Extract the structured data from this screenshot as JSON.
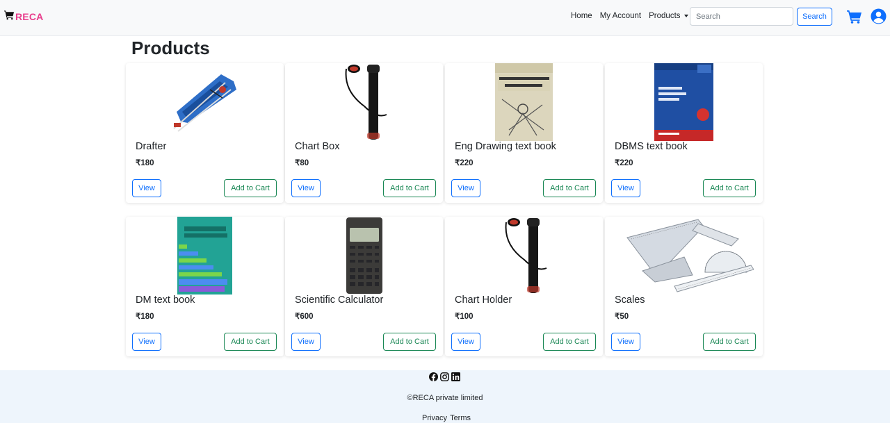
{
  "brand": {
    "name": "RECA",
    "color": "#e83e8c",
    "icon": "cart-icon"
  },
  "nav": {
    "home": "Home",
    "account": "My Account",
    "products": "Products",
    "search_placeholder": "Search",
    "search_button": "Search",
    "cart_icon": "cart-icon",
    "user_icon": "user-circle-icon",
    "accent": "#0d6efd"
  },
  "page": {
    "title": "Products"
  },
  "products": [
    {
      "name": "Drafter",
      "price": "₹180",
      "image": "drafter-image"
    },
    {
      "name": "Chart Box",
      "price": "₹80",
      "image": "chart-box-image"
    },
    {
      "name": "Eng Drawing text book",
      "price": "₹220",
      "image": "engineering-drawing-book-image"
    },
    {
      "name": "DBMS text book",
      "price": "₹220",
      "image": "dbms-book-image"
    },
    {
      "name": "DM text book",
      "price": "₹180",
      "image": "discrete-math-book-image"
    },
    {
      "name": "Scientific Calculator",
      "price": "₹600",
      "image": "calculator-image"
    },
    {
      "name": "Chart Holder",
      "price": "₹100",
      "image": "chart-holder-image"
    },
    {
      "name": "Scales",
      "price": "₹50",
      "image": "scales-set-image"
    }
  ],
  "buttons": {
    "view": "View",
    "add_to_cart": "Add to Cart",
    "view_color": "#0d6efd",
    "cart_color": "#198754"
  },
  "footer": {
    "social_icons": [
      "facebook-icon",
      "instagram-icon",
      "linkedin-icon"
    ],
    "copyright": "©RECA private limited",
    "privacy": "Privacy",
    "terms": "Terms",
    "background": "#eef5fc"
  }
}
